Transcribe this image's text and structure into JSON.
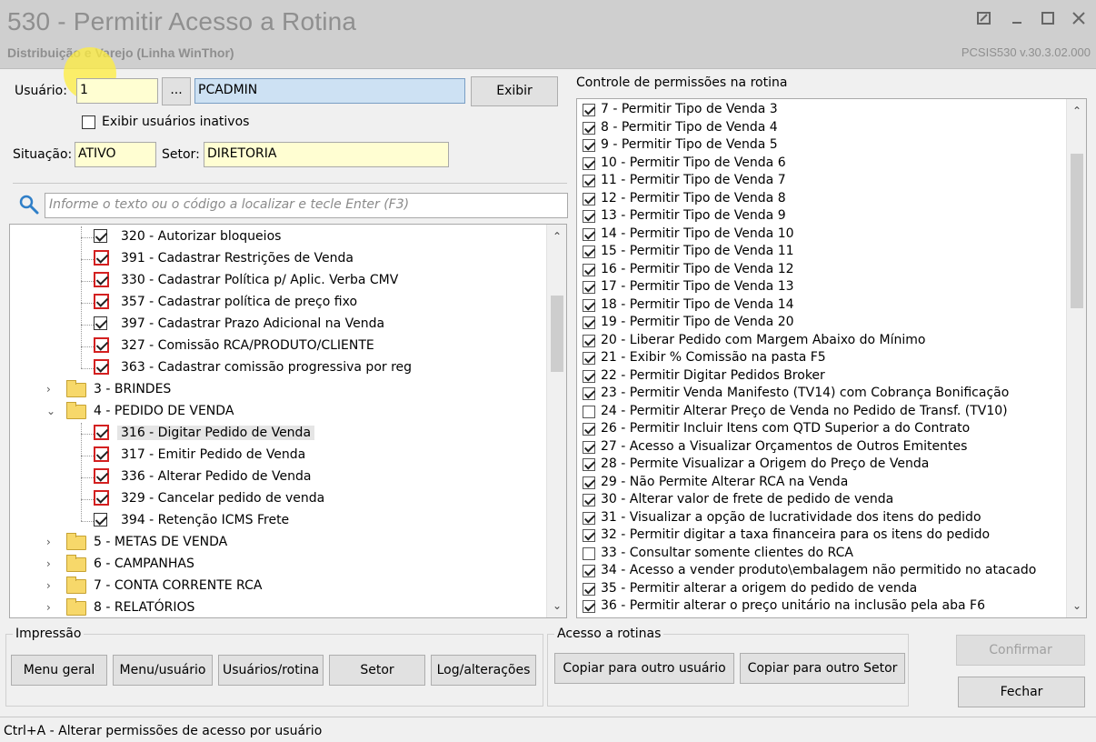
{
  "window": {
    "title": "530 - Permitir Acesso a Rotina",
    "subtitle": "Distribuição e Varejo (Linha WinThor)",
    "version": "PCSIS530  v.30.3.02.000"
  },
  "user_section": {
    "usuario_label": "Usuário:",
    "usuario_value": "1",
    "browse_label": "...",
    "user_name": "PCADMIN",
    "exibir_label": "Exibir",
    "inativos_label": "Exibir usuários inativos",
    "situacao_label": "Situação:",
    "situacao_value": "ATIVO",
    "setor_label": "Setor:",
    "setor_value": "DIRETORIA"
  },
  "search": {
    "placeholder": "Informe o texto ou o código a localizar e tecle Enter (F3)"
  },
  "tree": {
    "items": [
      {
        "level": 2,
        "checkbox": "black",
        "label": "320 - Autorizar bloqueios"
      },
      {
        "level": 2,
        "checkbox": "red",
        "label": "391 - Cadastrar Restrições de Venda"
      },
      {
        "level": 2,
        "checkbox": "red",
        "label": "330 - Cadastrar Política p/ Aplic. Verba CMV"
      },
      {
        "level": 2,
        "checkbox": "red",
        "label": "357 - Cadastrar política de preço fixo"
      },
      {
        "level": 2,
        "checkbox": "black",
        "label": "397 - Cadastrar Prazo Adicional na Venda"
      },
      {
        "level": 2,
        "checkbox": "red",
        "label": "327 - Comissão RCA/PRODUTO/CLIENTE"
      },
      {
        "level": 2,
        "checkbox": "red",
        "label": "363 - Cadastrar comissão progressiva por reg"
      },
      {
        "level": 1,
        "folder": true,
        "expander": "›",
        "label": "3 - BRINDES"
      },
      {
        "level": 1,
        "folder": true,
        "expander": "⌄",
        "label": "4 - PEDIDO DE VENDA"
      },
      {
        "level": 2,
        "checkbox": "red",
        "label": "316 - Digitar Pedido de Venda",
        "selected": true
      },
      {
        "level": 2,
        "checkbox": "red",
        "label": "317 - Emitir Pedido de Venda"
      },
      {
        "level": 2,
        "checkbox": "red",
        "label": "336 - Alterar Pedido de Venda"
      },
      {
        "level": 2,
        "checkbox": "red",
        "label": "329 - Cancelar pedido de venda"
      },
      {
        "level": 2,
        "checkbox": "black",
        "label": "394 - Retenção ICMS Frete"
      },
      {
        "level": 1,
        "folder": true,
        "expander": "›",
        "label": "5 - METAS DE VENDA"
      },
      {
        "level": 1,
        "folder": true,
        "expander": "›",
        "label": "6 - CAMPANHAS"
      },
      {
        "level": 1,
        "folder": true,
        "expander": "›",
        "label": "7 - CONTA CORRENTE RCA"
      },
      {
        "level": 1,
        "folder": true,
        "expander": "›",
        "label": "8 - RELATÓRIOS"
      }
    ]
  },
  "permissions": {
    "title": "Controle de permissões na rotina",
    "items": [
      {
        "checked": true,
        "label": "7 - Permitir Tipo de Venda 3"
      },
      {
        "checked": true,
        "label": "8 - Permitir Tipo de Venda 4"
      },
      {
        "checked": true,
        "label": "9 - Permitir Tipo de Venda 5"
      },
      {
        "checked": true,
        "label": "10 - Permitir Tipo de Venda 6"
      },
      {
        "checked": true,
        "label": "11 - Permitir Tipo de Venda 7"
      },
      {
        "checked": true,
        "label": "12 - Permitir Tipo de Venda 8"
      },
      {
        "checked": true,
        "label": "13 - Permitir Tipo de Venda 9"
      },
      {
        "checked": true,
        "label": "14 - Permitir Tipo de Venda 10"
      },
      {
        "checked": true,
        "label": "15 - Permitir Tipo de Venda 11"
      },
      {
        "checked": true,
        "label": "16 - Permitir Tipo de Venda 12"
      },
      {
        "checked": true,
        "label": "17 - Permitir Tipo de Venda 13"
      },
      {
        "checked": true,
        "label": "18 - Permitir Tipo de Venda 14"
      },
      {
        "checked": true,
        "label": "19 - Permitir Tipo de Venda 20"
      },
      {
        "checked": true,
        "label": "20 - Liberar Pedido com Margem Abaixo do Mínimo"
      },
      {
        "checked": true,
        "label": "21 - Exibir % Comissão na pasta F5"
      },
      {
        "checked": true,
        "label": "22 - Permitir Digitar Pedidos Broker"
      },
      {
        "checked": true,
        "label": "23 - Permitir Venda Manifesto (TV14) com Cobrança Bonificação"
      },
      {
        "checked": false,
        "label": "24 - Permitir Alterar Preço de Venda no Pedido de Transf. (TV10)"
      },
      {
        "checked": true,
        "label": "26 - Permitir Incluir Itens com QTD Superior a do Contrato"
      },
      {
        "checked": true,
        "label": "27 - Acesso a Visualizar Orçamentos de Outros Emitentes"
      },
      {
        "checked": true,
        "label": "28 - Permite Visualizar a Origem do Preço de Venda"
      },
      {
        "checked": true,
        "label": "29 - Não Permite Alterar RCA na Venda"
      },
      {
        "checked": true,
        "label": "30 - Alterar valor de frete de pedido de venda"
      },
      {
        "checked": true,
        "label": "31 - Visualizar a opção de lucratividade dos itens do pedido"
      },
      {
        "checked": true,
        "label": "32 - Permitir digitar a taxa financeira para os itens do pedido"
      },
      {
        "checked": false,
        "label": "33 - Consultar somente clientes do RCA"
      },
      {
        "checked": true,
        "label": "34 - Acesso a vender produto\\embalagem não permitido no atacado"
      },
      {
        "checked": true,
        "label": "35 - Permitir alterar a origem do pedido de venda"
      },
      {
        "checked": true,
        "label": "36 - Permitir alterar o preço unitário na inclusão pela aba F6"
      }
    ]
  },
  "impressao": {
    "title": "Impressão",
    "buttons": [
      "Menu geral",
      "Menu/usuário",
      "Usuários/rotina",
      "Setor",
      "Log/alterações"
    ]
  },
  "acesso": {
    "title": "Acesso a rotinas",
    "buttons": [
      "Copiar para outro usuário",
      "Copiar para outro Setor"
    ]
  },
  "actions": {
    "confirmar": "Confirmar",
    "fechar": "Fechar"
  },
  "status_bar": "Ctrl+A - Alterar permissões de acesso por usuário",
  "colors": {
    "field_bg": "#fffed2",
    "selected_field": "#cde1f3",
    "red_checkbox": "#d32020",
    "title_bar": "#cfcfcf"
  }
}
